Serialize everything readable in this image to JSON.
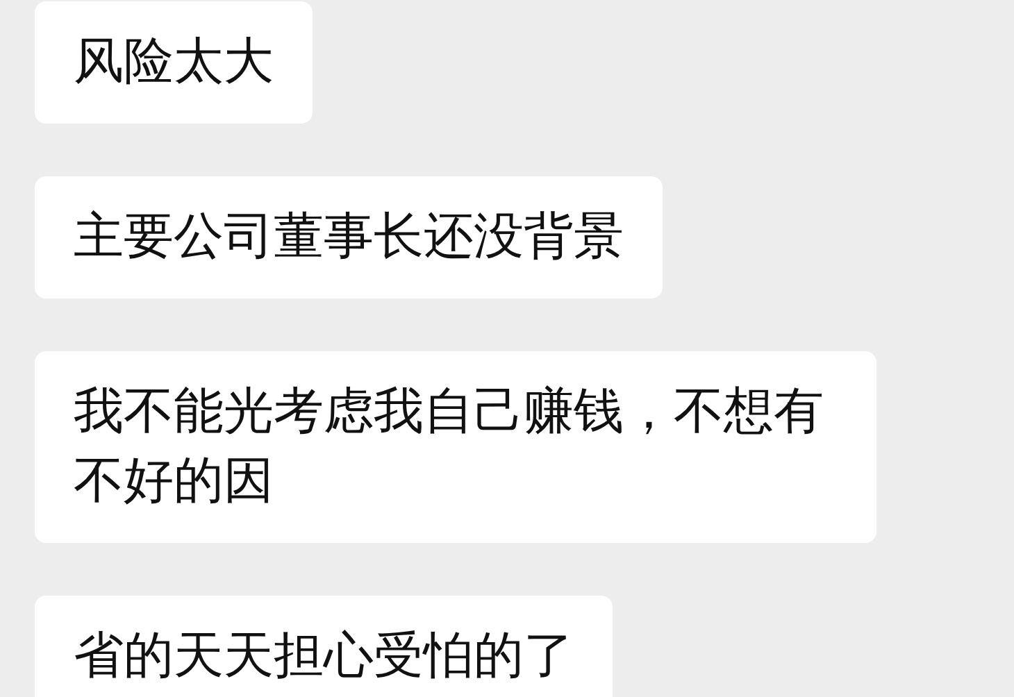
{
  "messages": [
    {
      "text": "风险太大"
    },
    {
      "text": "主要公司董事长还没背景"
    },
    {
      "text": "我不能光考虑我自己赚钱，不想有不好的因"
    },
    {
      "text": "省的天天担心受怕的了"
    }
  ]
}
